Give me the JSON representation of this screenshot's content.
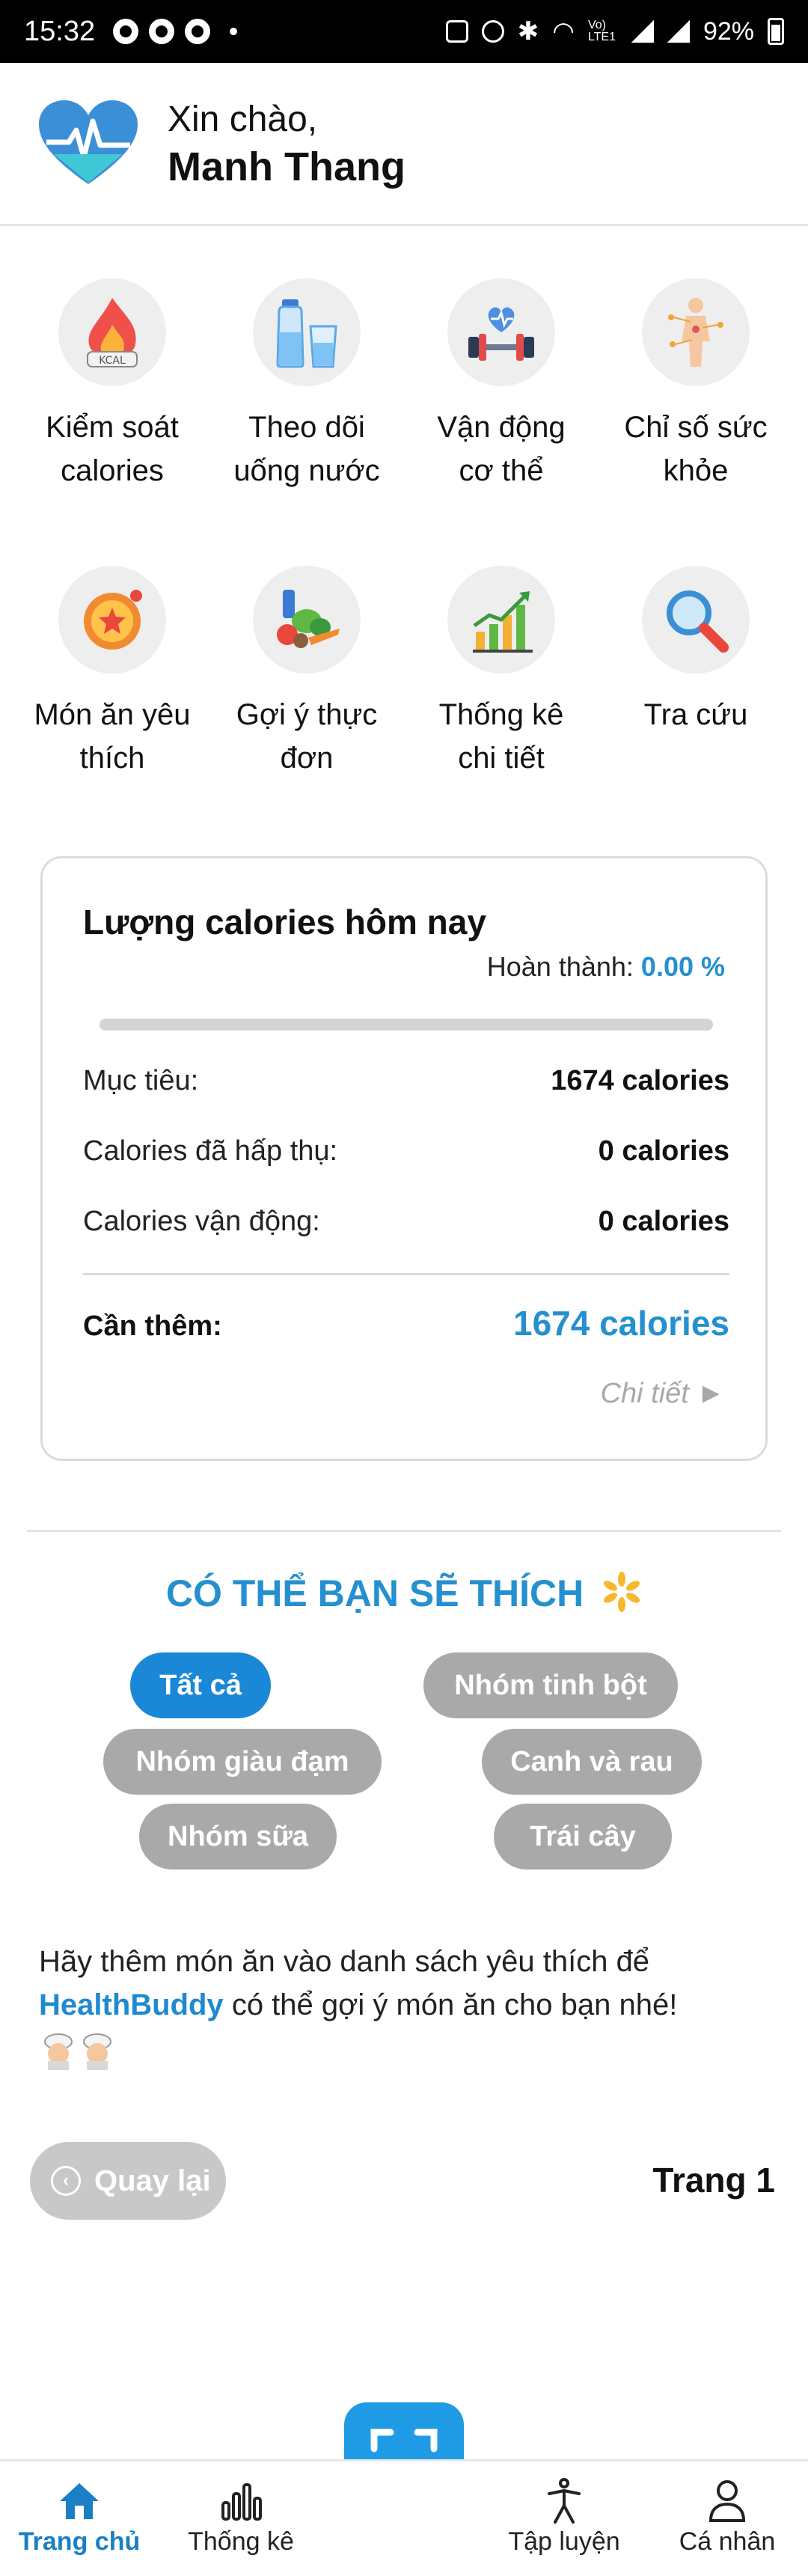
{
  "status_bar": {
    "time": "15:32",
    "network": "Vo) LTE1",
    "battery": "92%"
  },
  "header": {
    "greeting": "Xin chào,",
    "user_name": "Manh Thang"
  },
  "features": [
    {
      "label": "Kiểm soát calories",
      "icon": "calorie-flame-icon"
    },
    {
      "label": "Theo dõi uống nước",
      "icon": "water-bottle-icon"
    },
    {
      "label": "Vận động cơ thể",
      "icon": "dumbbell-heart-icon"
    },
    {
      "label": "Chỉ số sức khỏe",
      "icon": "body-chart-icon"
    },
    {
      "label": "Món ăn yêu thích",
      "icon": "favorite-food-icon"
    },
    {
      "label": "Gợi ý thực đơn",
      "icon": "vegetables-icon"
    },
    {
      "label": "Thống kê chi tiết",
      "icon": "growth-chart-icon"
    },
    {
      "label": "Tra cứu",
      "icon": "magnifier-icon"
    }
  ],
  "calories": {
    "title": "Lượng calories hôm nay",
    "complete_label": "Hoàn thành:",
    "complete_value": "0.00 %",
    "progress": 0,
    "target_label": "Mục tiêu:",
    "target_value": "1674 calories",
    "absorbed_label": "Calories đã hấp thụ:",
    "absorbed_value": "0 calories",
    "exercise_label": "Calories vận động:",
    "exercise_value": "0 calories",
    "need_label": "Cần thêm:",
    "need_value": "1674 calories",
    "detail_link": "Chi tiết ►"
  },
  "suggestions": {
    "title": "CÓ THỂ BẠN SẼ THÍCH",
    "chips": [
      "Tất cả",
      "Nhóm tinh bột",
      "Nhóm giàu đạm",
      "Canh và rau",
      "Nhóm sữa",
      "Trái cây"
    ],
    "active_chip": "Tất cả",
    "empty_message_before": "Hãy thêm món ăn vào danh sách yêu thích để",
    "brand": "HealthBuddy",
    "empty_message_after": "có thể gợi ý món ăn cho bạn nhé!"
  },
  "pagination": {
    "back_label": "Quay lại",
    "page_label": "Trang 1"
  },
  "bottom_nav": {
    "home": "Trang chủ",
    "stats": "Thống kê",
    "workout": "Tập luyện",
    "profile": "Cá nhân"
  },
  "colors": {
    "accent": "#2590cf",
    "chip_active": "#1a88d6",
    "chip_inactive": "#a9a9a9",
    "scan_button": "#1f9be6"
  }
}
